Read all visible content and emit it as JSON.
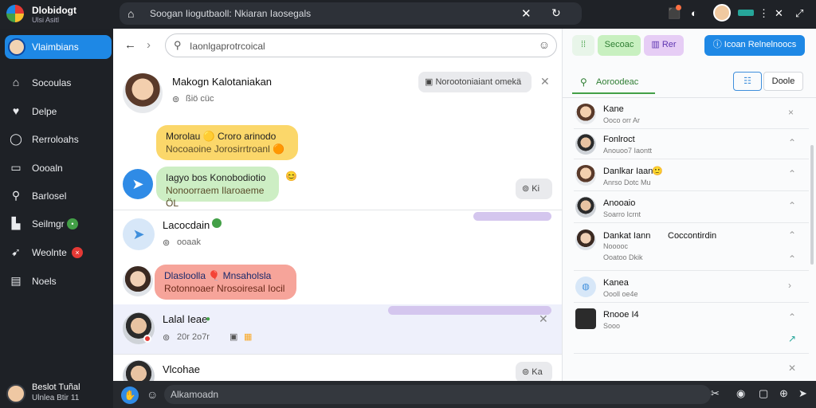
{
  "app": {
    "title": "Dlobidogt",
    "subtitle": "Ulsi Asitl"
  },
  "omnibox": {
    "text": "Soogan Iiogutbaoll: Nkiaran Iaosegals"
  },
  "sidebar": {
    "active_label": "Vlaimbians",
    "items": [
      {
        "icon": "home-icon",
        "label": "Socoulas"
      },
      {
        "icon": "heart-icon",
        "label": "Delpe"
      },
      {
        "icon": "bell-icon",
        "label": "Rerroloahs"
      },
      {
        "icon": "box-icon",
        "label": "Oooaln"
      },
      {
        "icon": "search-icon",
        "label": "Barlosel"
      },
      {
        "icon": "store-icon",
        "label": "Seilmgr",
        "badge_color": "#43a047"
      },
      {
        "icon": "pin-icon",
        "label": "Weolnte",
        "badge_color": "#e53935"
      },
      {
        "icon": "list-icon",
        "label": "Noels"
      }
    ],
    "user": {
      "name": "Beslot Tuñal",
      "status": "Ulnlea Btir 11"
    }
  },
  "chat": {
    "search_placeholder": "Iaonlgaprotrcoical",
    "header": {
      "name": "Makogn Kalotaniakan",
      "meta": "ßiö cüc",
      "chip": "Norootoniaiant omekä"
    },
    "bubble_yellow": {
      "line1": "Morolau 🟡 Croro arinodo",
      "line2": "Nocoaoine Jorosirrtroanl 🟠",
      "color": "#fbd76a"
    },
    "bubble_green": {
      "line1": "Iagyo bos Konobodiotio",
      "line2": "Nonoorraem Ilaroaeme ÖL",
      "color": "#cdeec4",
      "chip": "Ki"
    },
    "row3": {
      "name": "Lacocdain",
      "meta": "ooaak"
    },
    "bubble_red": {
      "line1": "Dlasloolla 🎈 Mnsaholsla",
      "line2": "Rotonnoaer Nrosoiresal Iocil",
      "color": "#f6a49a"
    },
    "row5": {
      "name": "Lalal Ieae",
      "meta": "20r 2o7r"
    },
    "row6": {
      "name": "Vlcohae",
      "chip": "Ka"
    }
  },
  "right": {
    "toolbar": {
      "green_btn": "Secoac",
      "violet_btn": "Rer",
      "blue_btn": "Icoan Relnelnoocs"
    },
    "tab": "Aoroodeac",
    "sort": "Doole",
    "items": [
      {
        "name": "Kane",
        "sub": "Ooco orr Ar",
        "action": "×"
      },
      {
        "name": "Fonlroct",
        "sub": "Anouoo7 Iaontt",
        "action": "⌃"
      },
      {
        "name": "Danlkar Iaan",
        "sub": "Anrso Dotc Mu",
        "action": "⌃"
      },
      {
        "name": "Anooaio",
        "sub": "Soarro Icrnt",
        "action": "⌃"
      },
      {
        "name": "Dankat Iann",
        "sub": "Nooooc",
        "sub2": "Ooatoo Dkik",
        "extra": "Coccontirdin",
        "action": "⌃"
      },
      {
        "name": "Kanea",
        "sub": "Oooll oe4e",
        "action": "›"
      },
      {
        "name": "Rnooe I4",
        "sub": "Sooo",
        "action": "⌃"
      }
    ]
  },
  "composer": {
    "placeholder": "Alkamoadn"
  }
}
